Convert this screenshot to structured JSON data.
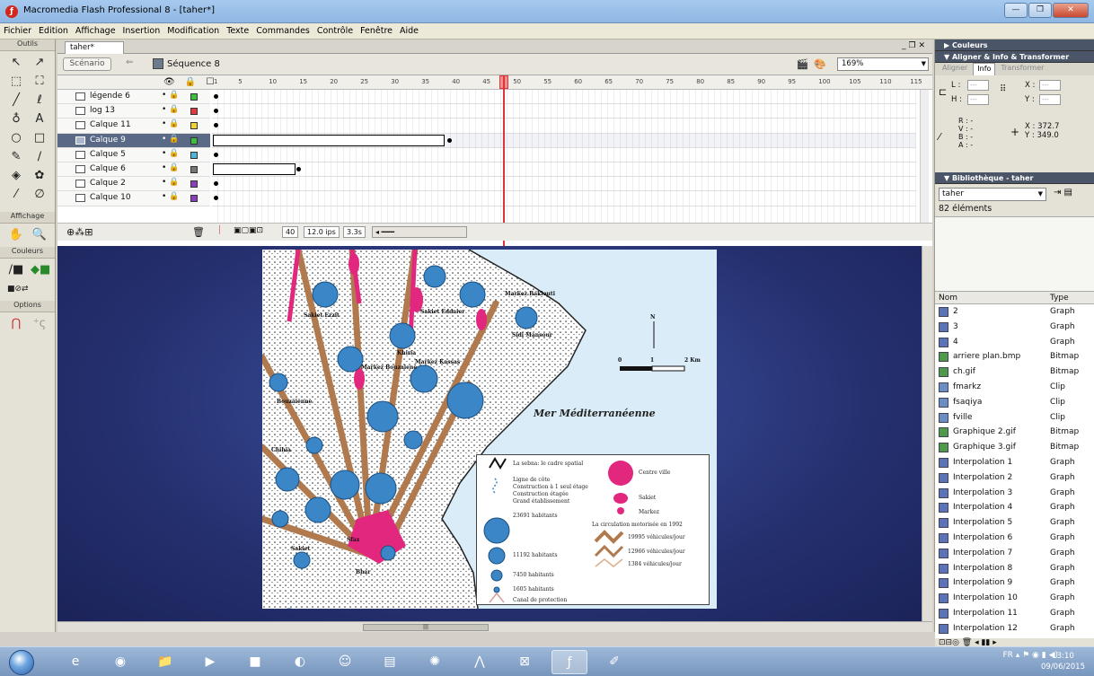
{
  "window": {
    "title": "Macromedia Flash Professional 8 - [taher*]",
    "buttons": {
      "minimize": "—",
      "restore": "❐",
      "close": "✕"
    }
  },
  "menubar": [
    "Fichier",
    "Edition",
    "Affichage",
    "Insertion",
    "Modification",
    "Texte",
    "Commandes",
    "Contrôle",
    "Fenêtre",
    "Aide"
  ],
  "toolbox": {
    "outils_label": "Outils",
    "affichage_label": "Affichage",
    "couleurs_label": "Couleurs",
    "options_label": "Options",
    "tools": [
      "↖",
      "↗",
      "⬚",
      "⛶",
      "╱",
      "ℓ",
      "♁",
      "A",
      "○",
      "□",
      "✎",
      "∕",
      "◈",
      "✿",
      "⁄",
      "∅"
    ]
  },
  "document": {
    "tab": "taher*",
    "scene_button": "Scénario",
    "sequence_label": "Séquence 8",
    "zoom": "169%",
    "doc_controls": "_ ❐ ✕"
  },
  "timeline": {
    "ruler_marks": [
      "1",
      "5",
      "10",
      "15",
      "20",
      "25",
      "30",
      "35",
      "40",
      "45",
      "50",
      "55",
      "60",
      "65",
      "70",
      "75",
      "80",
      "85",
      "90",
      "95",
      "100",
      "105",
      "110",
      "115"
    ],
    "header_icons": "👁 🔒 ☐",
    "layers": [
      {
        "name": "légende 6",
        "color": "#3fbf3f",
        "selected": false
      },
      {
        "name": "log 13",
        "color": "#e23a3a",
        "selected": false
      },
      {
        "name": "Calque 11",
        "color": "#f2d22c",
        "selected": false
      },
      {
        "name": "Calque 9",
        "color": "#3fbf3f",
        "selected": true
      },
      {
        "name": "Calque 5",
        "color": "#4fb6d8",
        "selected": false
      },
      {
        "name": "Calque 6",
        "color": "#777777",
        "selected": false
      },
      {
        "name": "Calque 2",
        "color": "#8a3fbf",
        "selected": false
      },
      {
        "name": "Calque 10",
        "color": "#8a3fbf",
        "selected": false
      }
    ],
    "footer": {
      "frame": "40",
      "fps": "12.0 ips",
      "time": "3.3s"
    }
  },
  "map": {
    "sea_label": "Mer Méditerranéenne",
    "places": [
      "Markez Baklouti",
      "Sakiet Ezzit",
      "Sakiet Eddaier",
      "Sidi Mansour",
      "Khiria",
      "Markez Kassas",
      "Markez Bouzaiene",
      "Bouzaienne",
      "Chihia",
      "Sakiet",
      "Sfax",
      "Bhar"
    ],
    "north": "N",
    "scale": {
      "zero": "0",
      "one": "1",
      "two": "2 Km"
    },
    "legend": {
      "coast_label": "La sebna: le cadre spatial",
      "line_label": "Ligne de côte",
      "c1": "Construction à 1 seul étage",
      "c2": "Construction étagée",
      "c3": "Grand établissement",
      "centre": "Centre ville",
      "sakiet": "Sakiet",
      "markez": "Markez",
      "circ_title": "La circulation motorisée en 1992",
      "v1": "19995 véhicules/jour",
      "v2": "12966 véhicules/jour",
      "v3": "1384 véhicules/jour",
      "p1": "23691 habitants",
      "p2": "11192 habitants",
      "p3": "7450 habitants",
      "p4": "1605 habitants",
      "canal": "Canal de protection"
    }
  },
  "panels": {
    "couleurs": "▶ Couleurs",
    "aligner": "▼ Aligner & Info & Transformer",
    "tabs": [
      "Aligner",
      "Info",
      "Transformer"
    ],
    "info": {
      "l": "L :",
      "h": "H :",
      "x": "X :",
      "y": "Y :",
      "placeholder": "---",
      "rgba": "R : -\nV : -\nB : -\nA : -",
      "coords_x": "X : 372.7",
      "coords_y": "Y : 349.0"
    },
    "bibliotheque": "▼ Bibliothèque - taher",
    "library_select": "taher",
    "library_count": "82 éléments",
    "col_name": "Nom",
    "col_type": "Type",
    "items": [
      {
        "name": "2",
        "type": "Graph",
        "kind": "graph"
      },
      {
        "name": "3",
        "type": "Graph",
        "kind": "graph"
      },
      {
        "name": "4",
        "type": "Graph",
        "kind": "graph"
      },
      {
        "name": "arriere plan.bmp",
        "type": "Bitmap",
        "kind": "bitmap"
      },
      {
        "name": "ch.gif",
        "type": "Bitmap",
        "kind": "bitmap"
      },
      {
        "name": "fmarkz",
        "type": "Clip",
        "kind": "clip"
      },
      {
        "name": "fsaqiya",
        "type": "Clip",
        "kind": "clip"
      },
      {
        "name": "fville",
        "type": "Clip",
        "kind": "clip"
      },
      {
        "name": "Graphique 2.gif",
        "type": "Bitmap",
        "kind": "bitmap"
      },
      {
        "name": "Graphique 3.gif",
        "type": "Bitmap",
        "kind": "bitmap"
      },
      {
        "name": "Interpolation 1",
        "type": "Graph",
        "kind": "graph"
      },
      {
        "name": "Interpolation 2",
        "type": "Graph",
        "kind": "graph"
      },
      {
        "name": "Interpolation 3",
        "type": "Graph",
        "kind": "graph"
      },
      {
        "name": "Interpolation 4",
        "type": "Graph",
        "kind": "graph"
      },
      {
        "name": "Interpolation 5",
        "type": "Graph",
        "kind": "graph"
      },
      {
        "name": "Interpolation 6",
        "type": "Graph",
        "kind": "graph"
      },
      {
        "name": "Interpolation 7",
        "type": "Graph",
        "kind": "graph"
      },
      {
        "name": "Interpolation 8",
        "type": "Graph",
        "kind": "graph"
      },
      {
        "name": "Interpolation 9",
        "type": "Graph",
        "kind": "graph"
      },
      {
        "name": "Interpolation 10",
        "type": "Graph",
        "kind": "graph"
      },
      {
        "name": "Interpolation 11",
        "type": "Graph",
        "kind": "graph"
      },
      {
        "name": "Interpolation 12",
        "type": "Graph",
        "kind": "graph"
      }
    ]
  },
  "taskbar": {
    "apps": [
      "e",
      "◉",
      "📁",
      "▶",
      "■",
      "◐",
      "☺",
      "▤",
      "✺",
      "⋀",
      "⊠",
      "ƒ",
      "✐"
    ],
    "tray": "FR ▴ ⚑ ◉ ▮ ◀)",
    "time": "13:10",
    "date": "09/06/2015"
  },
  "colors": {
    "accent": "#e0333a",
    "pop_circle": "#3a86c6",
    "centre": "#e2277e",
    "road": "#b07a4e",
    "sea": "#d9ecf7"
  }
}
